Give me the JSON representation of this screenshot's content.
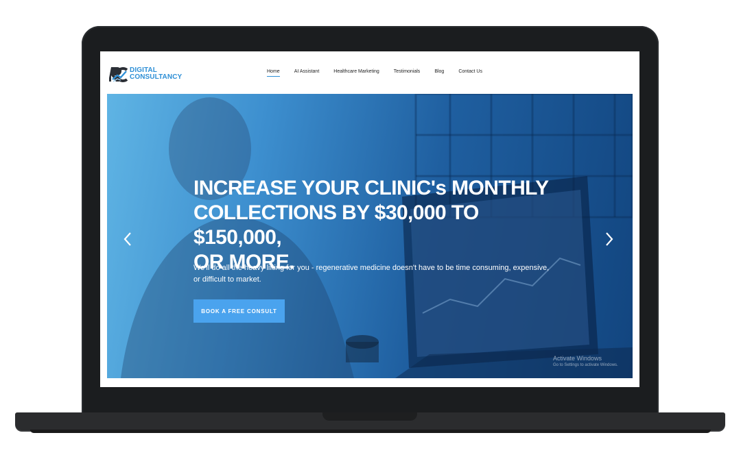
{
  "brand": {
    "line1": "DIGITAL",
    "line2": "CONSULTANCY",
    "logo_icon": "rc-monogram-icon",
    "color": "#2e8fd6"
  },
  "nav": {
    "items": [
      {
        "label": "Home",
        "active": true
      },
      {
        "label": "AI Assistant",
        "active": false
      },
      {
        "label": "Healthcare Marketing",
        "active": false
      },
      {
        "label": "Testimonials",
        "active": false
      },
      {
        "label": "Blog",
        "active": false
      },
      {
        "label": "Contact Us",
        "active": false
      }
    ]
  },
  "hero": {
    "title_line1": "INCREASE YOUR CLINIC's MONTHLY",
    "title_line2": "COLLECTIONS BY $30,000 TO $150,000,",
    "title_line3": "OR MORE.",
    "subtitle": "We'll do all the heavy lifting for you - regenerative medicine doesn't have to be time consuming, expensive, or difficult to market.",
    "cta_label": "BOOK A FREE CONSULT",
    "cta_color": "#4aa3ee",
    "prev_icon": "chevron-left-icon",
    "next_icon": "chevron-right-icon"
  },
  "watermark": {
    "title": "Activate Windows",
    "subtitle": "Go to Settings to activate Windows."
  }
}
